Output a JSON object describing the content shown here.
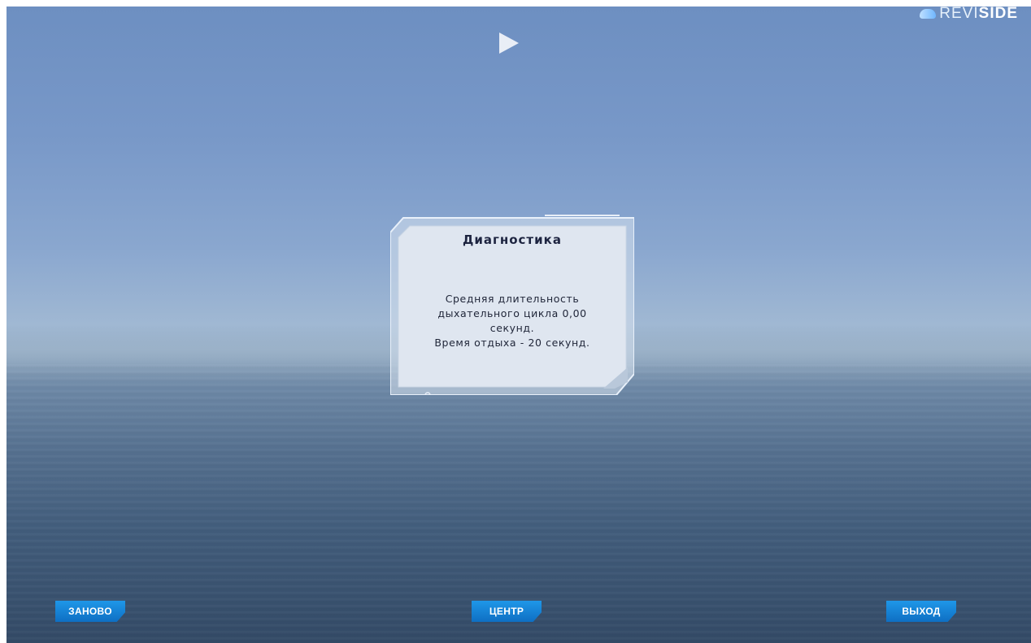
{
  "brand": {
    "logo_light": "REVI",
    "logo_bold": "SIDE"
  },
  "player": {
    "play_icon": "play-icon"
  },
  "dialog": {
    "title": "Диагностика",
    "lines": [
      "Средняя длительность",
      "дыхательного цикла  0,00",
      "секунд.",
      "Время отдыха -  20 секунд."
    ]
  },
  "footer": {
    "restart_label": "ЗАНОВО",
    "center_label": "ЦЕНТР",
    "exit_label": "ВЫХОД"
  },
  "colors": {
    "accent": "#1a8be0",
    "panel_bg": "#dde4ef",
    "panel_border": "#e6eef8"
  }
}
